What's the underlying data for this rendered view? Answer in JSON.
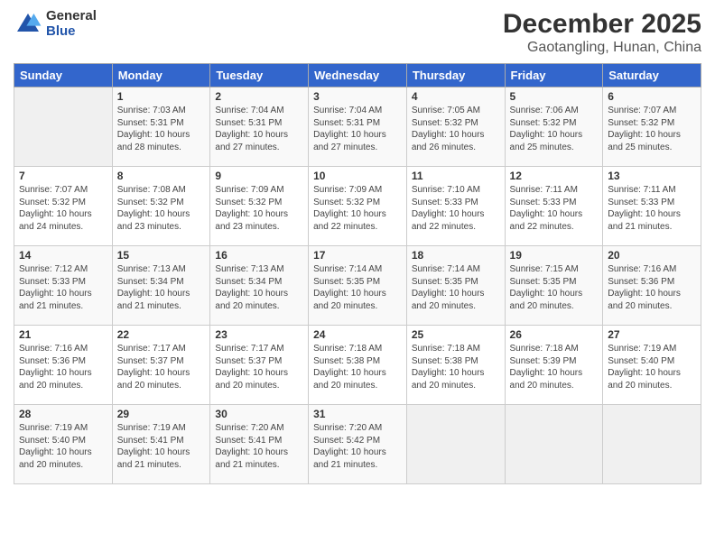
{
  "header": {
    "logo_general": "General",
    "logo_blue": "Blue",
    "month_title": "December 2025",
    "location": "Gaotangling, Hunan, China"
  },
  "days_of_week": [
    "Sunday",
    "Monday",
    "Tuesday",
    "Wednesday",
    "Thursday",
    "Friday",
    "Saturday"
  ],
  "weeks": [
    [
      {
        "day": "",
        "empty": true
      },
      {
        "day": "1",
        "sunrise": "7:03 AM",
        "sunset": "5:31 PM",
        "daylight": "10 hours and 28 minutes."
      },
      {
        "day": "2",
        "sunrise": "7:04 AM",
        "sunset": "5:31 PM",
        "daylight": "10 hours and 27 minutes."
      },
      {
        "day": "3",
        "sunrise": "7:04 AM",
        "sunset": "5:31 PM",
        "daylight": "10 hours and 27 minutes."
      },
      {
        "day": "4",
        "sunrise": "7:05 AM",
        "sunset": "5:32 PM",
        "daylight": "10 hours and 26 minutes."
      },
      {
        "day": "5",
        "sunrise": "7:06 AM",
        "sunset": "5:32 PM",
        "daylight": "10 hours and 25 minutes."
      },
      {
        "day": "6",
        "sunrise": "7:07 AM",
        "sunset": "5:32 PM",
        "daylight": "10 hours and 25 minutes."
      }
    ],
    [
      {
        "day": "7",
        "sunrise": "7:07 AM",
        "sunset": "5:32 PM",
        "daylight": "10 hours and 24 minutes."
      },
      {
        "day": "8",
        "sunrise": "7:08 AM",
        "sunset": "5:32 PM",
        "daylight": "10 hours and 23 minutes."
      },
      {
        "day": "9",
        "sunrise": "7:09 AM",
        "sunset": "5:32 PM",
        "daylight": "10 hours and 23 minutes."
      },
      {
        "day": "10",
        "sunrise": "7:09 AM",
        "sunset": "5:32 PM",
        "daylight": "10 hours and 22 minutes."
      },
      {
        "day": "11",
        "sunrise": "7:10 AM",
        "sunset": "5:33 PM",
        "daylight": "10 hours and 22 minutes."
      },
      {
        "day": "12",
        "sunrise": "7:11 AM",
        "sunset": "5:33 PM",
        "daylight": "10 hours and 22 minutes."
      },
      {
        "day": "13",
        "sunrise": "7:11 AM",
        "sunset": "5:33 PM",
        "daylight": "10 hours and 21 minutes."
      }
    ],
    [
      {
        "day": "14",
        "sunrise": "7:12 AM",
        "sunset": "5:33 PM",
        "daylight": "10 hours and 21 minutes."
      },
      {
        "day": "15",
        "sunrise": "7:13 AM",
        "sunset": "5:34 PM",
        "daylight": "10 hours and 21 minutes."
      },
      {
        "day": "16",
        "sunrise": "7:13 AM",
        "sunset": "5:34 PM",
        "daylight": "10 hours and 20 minutes."
      },
      {
        "day": "17",
        "sunrise": "7:14 AM",
        "sunset": "5:35 PM",
        "daylight": "10 hours and 20 minutes."
      },
      {
        "day": "18",
        "sunrise": "7:14 AM",
        "sunset": "5:35 PM",
        "daylight": "10 hours and 20 minutes."
      },
      {
        "day": "19",
        "sunrise": "7:15 AM",
        "sunset": "5:35 PM",
        "daylight": "10 hours and 20 minutes."
      },
      {
        "day": "20",
        "sunrise": "7:16 AM",
        "sunset": "5:36 PM",
        "daylight": "10 hours and 20 minutes."
      }
    ],
    [
      {
        "day": "21",
        "sunrise": "7:16 AM",
        "sunset": "5:36 PM",
        "daylight": "10 hours and 20 minutes."
      },
      {
        "day": "22",
        "sunrise": "7:17 AM",
        "sunset": "5:37 PM",
        "daylight": "10 hours and 20 minutes."
      },
      {
        "day": "23",
        "sunrise": "7:17 AM",
        "sunset": "5:37 PM",
        "daylight": "10 hours and 20 minutes."
      },
      {
        "day": "24",
        "sunrise": "7:18 AM",
        "sunset": "5:38 PM",
        "daylight": "10 hours and 20 minutes."
      },
      {
        "day": "25",
        "sunrise": "7:18 AM",
        "sunset": "5:38 PM",
        "daylight": "10 hours and 20 minutes."
      },
      {
        "day": "26",
        "sunrise": "7:18 AM",
        "sunset": "5:39 PM",
        "daylight": "10 hours and 20 minutes."
      },
      {
        "day": "27",
        "sunrise": "7:19 AM",
        "sunset": "5:40 PM",
        "daylight": "10 hours and 20 minutes."
      }
    ],
    [
      {
        "day": "28",
        "sunrise": "7:19 AM",
        "sunset": "5:40 PM",
        "daylight": "10 hours and 20 minutes."
      },
      {
        "day": "29",
        "sunrise": "7:19 AM",
        "sunset": "5:41 PM",
        "daylight": "10 hours and 21 minutes."
      },
      {
        "day": "30",
        "sunrise": "7:20 AM",
        "sunset": "5:41 PM",
        "daylight": "10 hours and 21 minutes."
      },
      {
        "day": "31",
        "sunrise": "7:20 AM",
        "sunset": "5:42 PM",
        "daylight": "10 hours and 21 minutes."
      },
      {
        "day": "",
        "empty": true
      },
      {
        "day": "",
        "empty": true
      },
      {
        "day": "",
        "empty": true
      }
    ]
  ],
  "labels": {
    "sunrise": "Sunrise:",
    "sunset": "Sunset:",
    "daylight": "Daylight:"
  }
}
